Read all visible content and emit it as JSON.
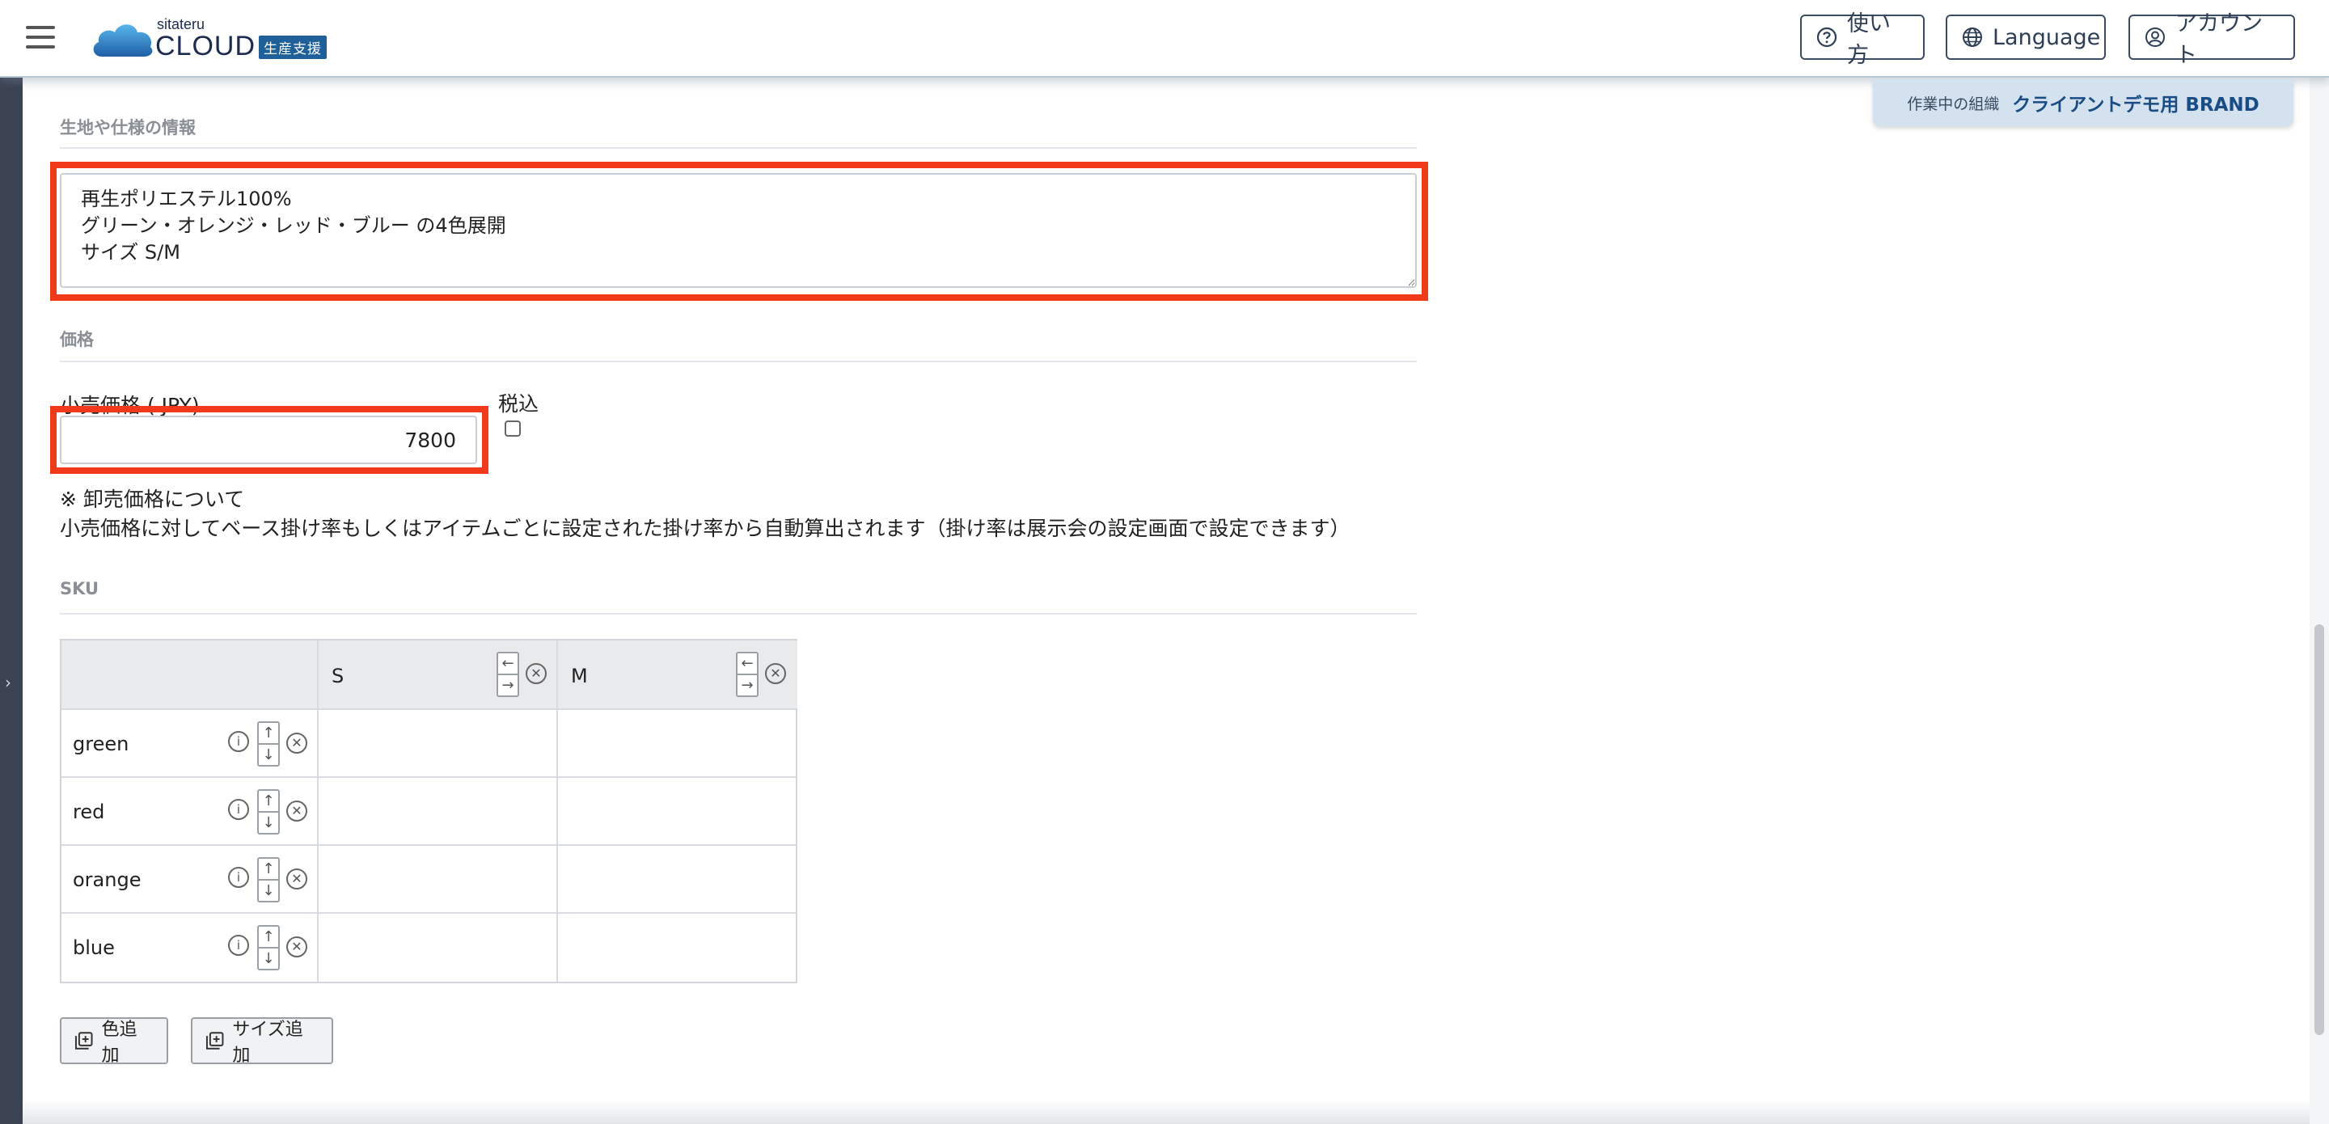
{
  "header": {
    "logo_top": "sitateru",
    "logo_main": "CLOUD",
    "logo_badge": "生産支援",
    "help_label": "使い方",
    "language_label": "Language",
    "account_label": "アカウント"
  },
  "org": {
    "label": "作業中の組織",
    "value": "クライアントデモ用 BRAND"
  },
  "spec_section": {
    "title": "生地や仕様の情報",
    "text": "再生ポリエステル100%\nグリーン・オレンジ・レッド・ブルー の4色展開\nサイズ S/M"
  },
  "price_section": {
    "title": "価格",
    "retail_label": "小売価格 ( JPY)",
    "retail_value": "7800",
    "tax_label": "税込",
    "tax_included": false,
    "note_title": "※ 卸売価格について",
    "note_body": "小売価格に対してベース掛け率もしくはアイテムごとに設定された掛け率から自動算出されます（掛け率は展示会の設定画面で設定できます）"
  },
  "sku_section": {
    "title": "SKU",
    "sizes": [
      "S",
      "M"
    ],
    "colors": [
      "green",
      "red",
      "orange",
      "blue"
    ],
    "add_color_label": "色追加",
    "add_size_label": "サイズ追加"
  },
  "icons": {
    "menu": "hamburger-icon",
    "help": "question-circle-icon",
    "language": "globe-icon",
    "account": "user-circle-icon",
    "info": "info-circle-icon",
    "remove": "x-circle-icon",
    "move_left": "arrow-left-icon",
    "move_right": "arrow-right-icon",
    "move_up": "arrow-up-icon",
    "move_down": "arrow-down-icon",
    "add": "plus-square-icon",
    "rail_toggle": "chevron-right-icon"
  },
  "colors": {
    "highlight": "#f03a1a",
    "brand": "#1d2b4f",
    "org_tab": "#d3e2ee",
    "org_value": "#1a4d86"
  }
}
